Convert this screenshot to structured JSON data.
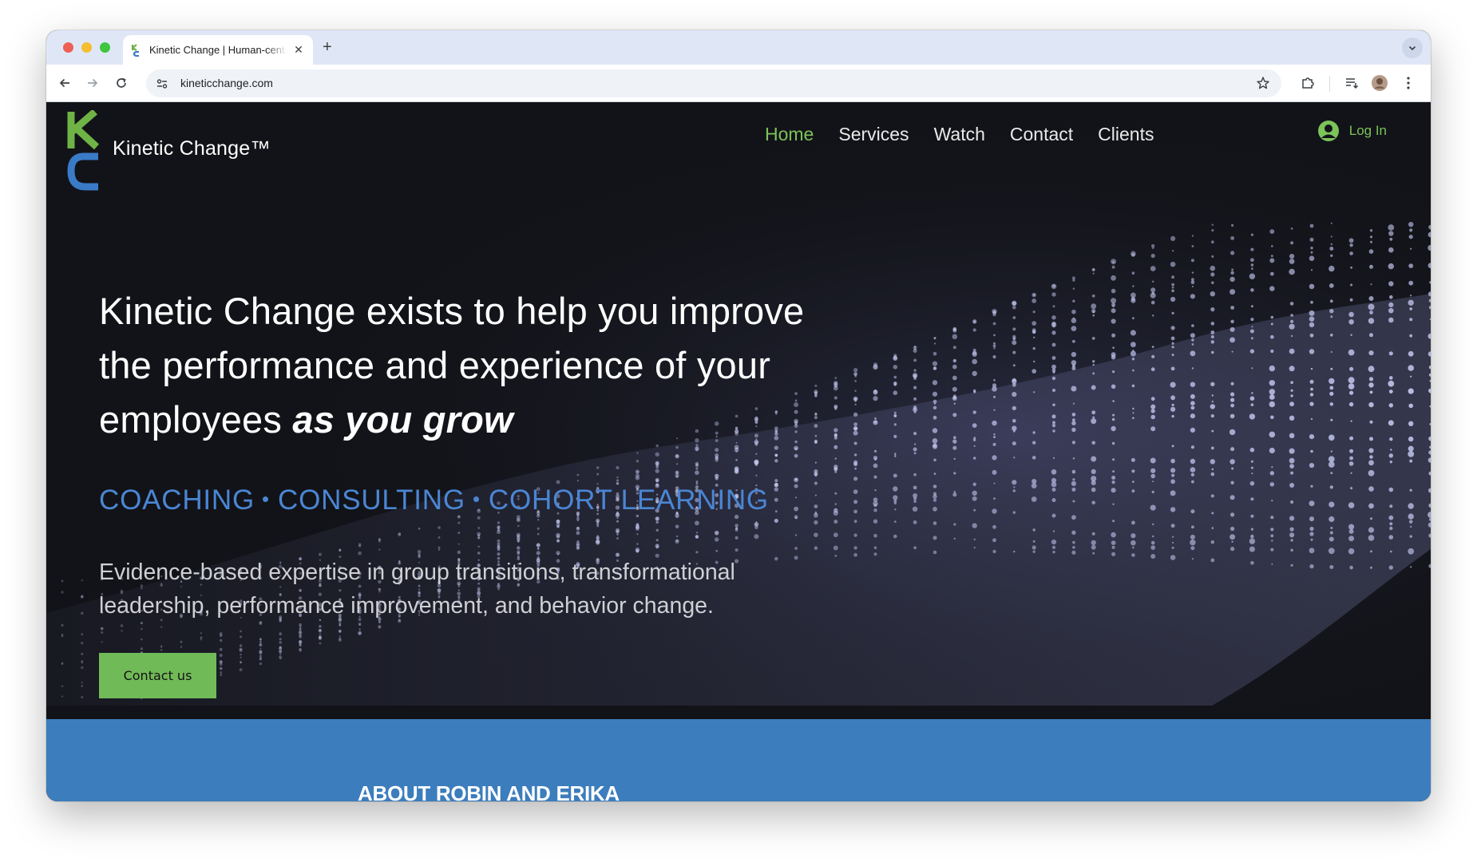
{
  "browser": {
    "tab_title": "Kinetic Change | Human-centered",
    "url": "kineticchange.com"
  },
  "site": {
    "brand": "Kinetic Change™",
    "nav": [
      {
        "label": "Home",
        "active": true
      },
      {
        "label": "Services"
      },
      {
        "label": "Watch"
      },
      {
        "label": "Contact"
      },
      {
        "label": "Clients"
      }
    ],
    "login_label": "Log In"
  },
  "hero": {
    "headline_main": "Kinetic Change exists to help you improve the performance and experience of your employees ",
    "headline_emphasis": "as you grow",
    "services": [
      "COACHING",
      "CONSULTING",
      "COHORT LEARNING"
    ],
    "subtext": "Evidence-based expertise in group transitions, transformational leadership, performance improvement, and behavior change.",
    "cta_label": "Contact us"
  },
  "about": {
    "title": "ABOUT ROBIN AND ERIKA"
  },
  "colors": {
    "accent_green": "#7cc35a",
    "accent_blue": "#4a86d4",
    "band_blue": "#3c7dbd",
    "hero_bg": "#121318"
  }
}
